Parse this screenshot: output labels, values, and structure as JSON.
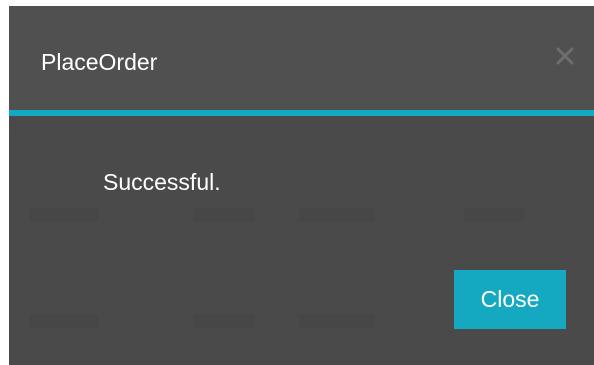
{
  "dialog": {
    "title": "PlaceOrder",
    "close_icon": "close-x-icon",
    "message": "Successful.",
    "close_button_label": "Close"
  },
  "colors": {
    "accent": "#15a8c1",
    "dialog_background": "#4b4b4b",
    "text": "#ffffff",
    "close_icon": "#6e6e6e"
  }
}
